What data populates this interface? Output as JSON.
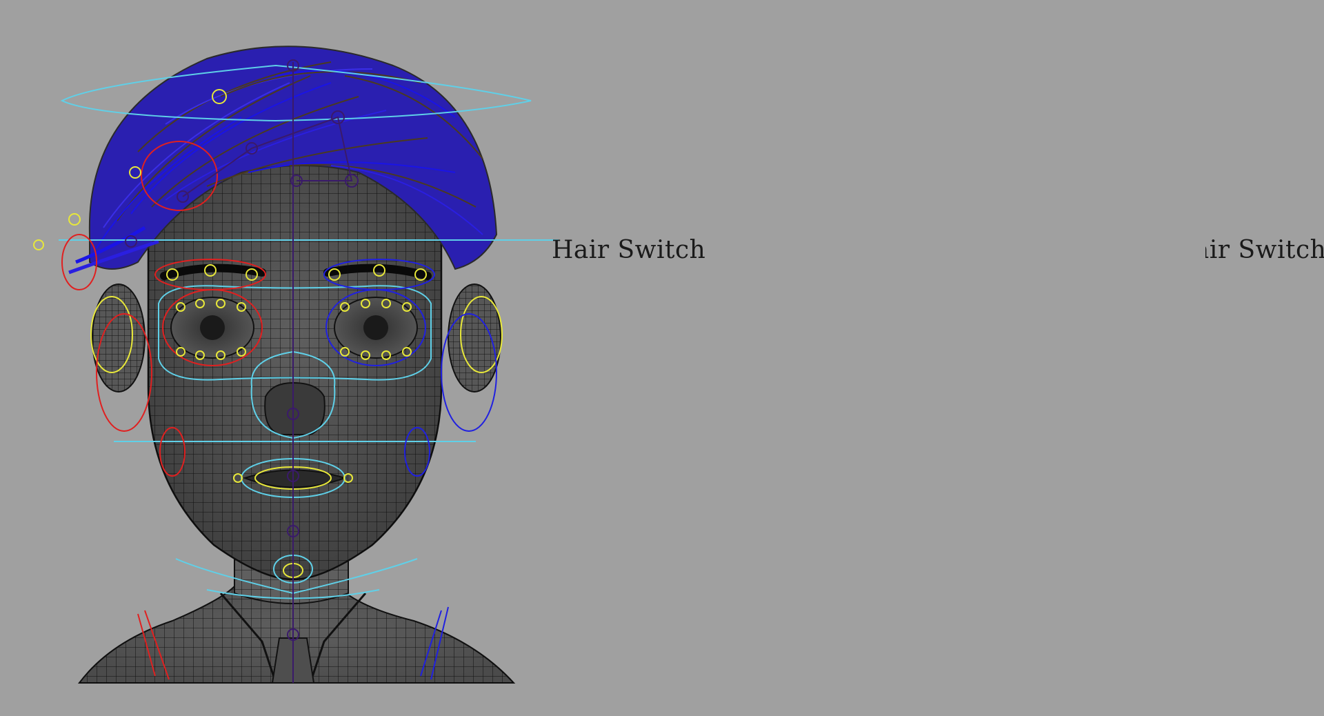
{
  "viewport": {
    "background": "#a0a0a0",
    "mesh_color": "#5e5e5e",
    "wire_color": "#141414",
    "hair_blue": "#1a14e6",
    "hair_brown": "#4a3a20",
    "ctrl_cyan": "#5fd0e8",
    "ctrl_yellow": "#e8e83a",
    "ctrl_red": "#e02020",
    "ctrl_blue": "#2020e0",
    "joint_purple": "#3a1a6a"
  },
  "front_view": {
    "hair_switch": {
      "label": "Hair Switch",
      "state": "off"
    }
  },
  "side_view": {
    "hair_switch": {
      "label": "Hair Switch",
      "state": "off"
    }
  }
}
